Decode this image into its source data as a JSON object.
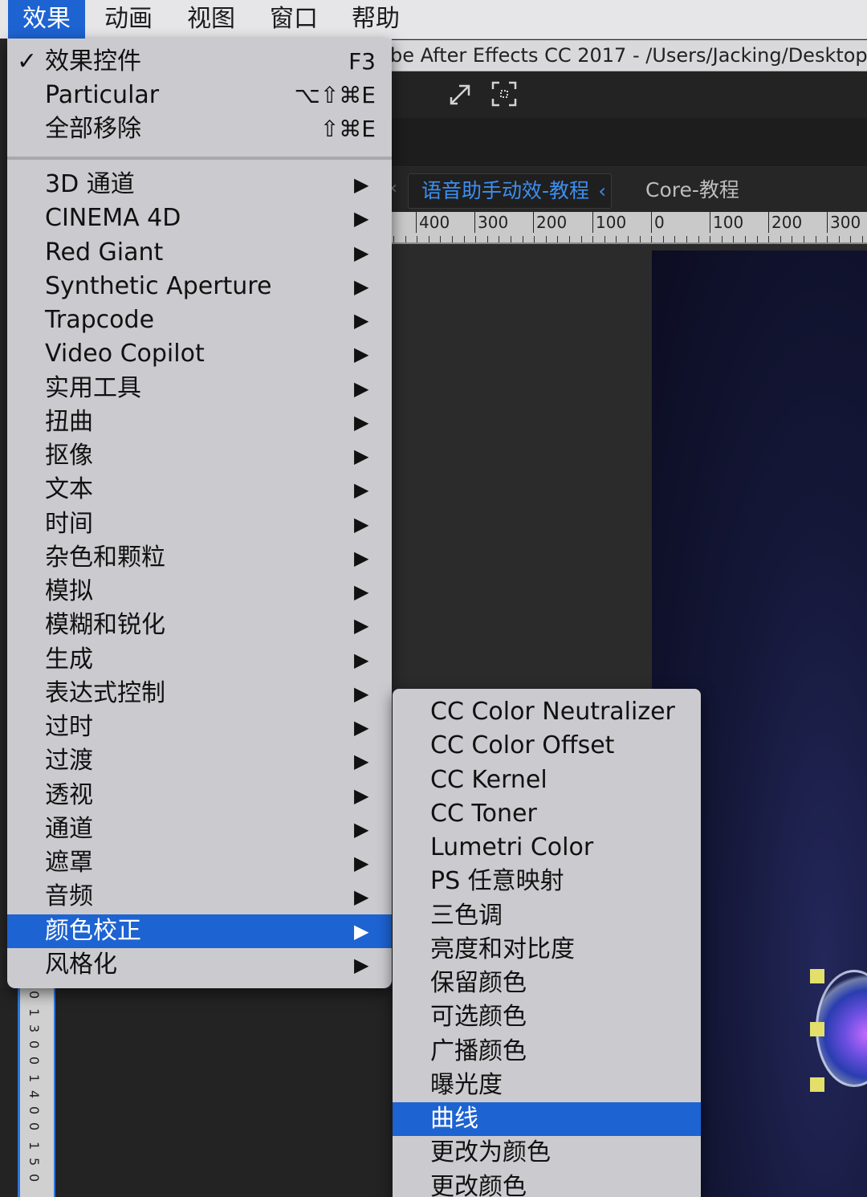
{
  "menubar": {
    "items": [
      "效果",
      "动画",
      "视图",
      "窗口",
      "帮助"
    ],
    "active": "效果"
  },
  "window": {
    "title": "be After Effects CC 2017 - /Users/Jacking/Desktop"
  },
  "composition": {
    "active_tab": "语音助手动效-教程",
    "other_tab": "Core-教程",
    "ruler_labels": [
      "400",
      "300",
      "200",
      "100",
      "0",
      "100",
      "200",
      "300"
    ],
    "left_ruler_labels": [
      "0",
      "1",
      "3",
      "0",
      "0",
      "1",
      "4",
      "0",
      "0",
      "1",
      "5",
      "0"
    ]
  },
  "effects_menu": {
    "top_items": [
      {
        "label": "效果控件",
        "shortcut": "F3",
        "checked": true
      },
      {
        "label": "Particular",
        "shortcut": "⌥⇧⌘E"
      },
      {
        "label": "全部移除",
        "shortcut": "⇧⌘E"
      }
    ],
    "categories": [
      "3D 通道",
      "CINEMA 4D",
      "Red Giant",
      "Synthetic Aperture",
      "Trapcode",
      "Video Copilot",
      "实用工具",
      "扭曲",
      "抠像",
      "文本",
      "时间",
      "杂色和颗粒",
      "模拟",
      "模糊和锐化",
      "生成",
      "表达式控制",
      "过时",
      "过渡",
      "透视",
      "通道",
      "遮罩",
      "音频",
      "颜色校正",
      "风格化"
    ],
    "highlighted": "颜色校正",
    "check_glyph": "✓",
    "arrow_glyph": "▶"
  },
  "color_correction_submenu": {
    "items": [
      "CC Color Neutralizer",
      "CC Color Offset",
      "CC Kernel",
      "CC Toner",
      "Lumetri Color",
      "PS 任意映射",
      "三色调",
      "亮度和对比度",
      "保留颜色",
      "可选颜色",
      "广播颜色",
      "曝光度",
      "曲线",
      "更改为颜色",
      "更改颜色"
    ],
    "highlighted": "曲线"
  },
  "colors": {
    "accent": "#1d63d2",
    "menu_bg": "#cbcbcf",
    "tab_active": "#3d8ff0"
  }
}
